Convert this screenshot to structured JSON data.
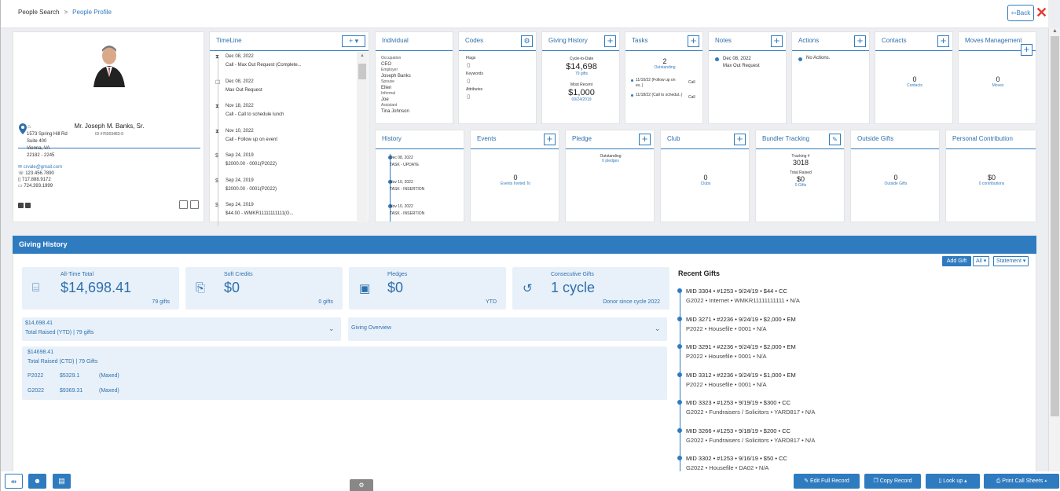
{
  "breadcrumb": {
    "home": "People Search",
    "sep": ">",
    "current": "People Profile"
  },
  "header": {
    "back_label": "Back",
    "close_label": "✕"
  },
  "profile": {
    "name": "Mr. Joseph M. Banks, Sr.",
    "id": "ID #76003483-9",
    "addr1": "1573 Spring Hill Rd",
    "addr2": "Suite 400",
    "addr3": "Vienna, VA",
    "addr4": "22182 - 2245",
    "email": "crvale@gmail.com",
    "phone1": "123.456.7890",
    "phone2": "717.888.9172",
    "phone3": "724.393.1999",
    "home_glyph": "⌂"
  },
  "timeline": {
    "title": "TimeLine",
    "add_label": "+ ▾",
    "items": [
      {
        "date": "Dec 08, 2022",
        "text": "Call - Max Out Request (Complete..."
      },
      {
        "date": "Dec 08, 2022",
        "text": "Max Out Request"
      },
      {
        "date": "Nov 18, 2022",
        "text": "Call - Call to schedule lunch"
      },
      {
        "date": "Nov 10, 2022",
        "text": "Call - Follow up on event"
      },
      {
        "date": "Sep 24, 2019",
        "text": "$2000.00 - 0001(P2022)"
      },
      {
        "date": "Sep 24, 2019",
        "text": "$2000.00 - 0001(P2022)"
      },
      {
        "date": "Sep 24, 2019",
        "text": "$44.00 - WMKR11111111111(G..."
      }
    ]
  },
  "individual": {
    "title": "Individual",
    "rows": [
      {
        "label": "Occupation",
        "value": "CEO"
      },
      {
        "label": "Employer",
        "value": "Joseph Banks"
      },
      {
        "label": "Spouse",
        "value": "Ellen"
      },
      {
        "label": "Informal",
        "value": "Joe"
      },
      {
        "label": "Assistant",
        "value": "Tina Johnson"
      }
    ]
  },
  "codes": {
    "title": "Codes",
    "rows": [
      {
        "label": "Flags",
        "value": "0"
      },
      {
        "label": "Keywords",
        "value": "0"
      },
      {
        "label": "Attributes",
        "value": "0"
      }
    ]
  },
  "giving_history_card": {
    "title": "Giving History",
    "cycle_label": "Cycle-to-Date",
    "cycle_value": "$14,698",
    "cycle_gifts": "79 gifts",
    "recent_label": "Most Recent",
    "recent_value": "$1,000",
    "recent_date": "09/24/2019"
  },
  "tasks": {
    "title": "Tasks",
    "count": "2",
    "count_label": "Outstanding",
    "items": [
      {
        "text": "11/10/22 (Follow up on ev..)",
        "type": "Call"
      },
      {
        "text": "11/18/22 (Call to schedul..)",
        "type": "Call"
      }
    ]
  },
  "notes": {
    "title": "Notes",
    "date": "Dec 08, 2022",
    "text": "Max Out Request"
  },
  "actions": {
    "title": "Actions",
    "text": "No Actions."
  },
  "contacts": {
    "title": "Contacts",
    "value": "0",
    "label": "Contacts"
  },
  "moves": {
    "title": "Moves Management",
    "value": "0",
    "label": "Moves"
  },
  "history": {
    "title": "History",
    "items": [
      {
        "date": "Dec 08, 2022",
        "text": "TASK - UPDATE"
      },
      {
        "date": "Nov 10, 2022",
        "text": "TASK - INSERTION"
      },
      {
        "date": "Nov 10, 2022",
        "text": "TASK - INSERTION"
      }
    ]
  },
  "events": {
    "title": "Events",
    "value": "0",
    "label": "Events Invited To"
  },
  "pledge": {
    "title": "Pledge",
    "label": "Outstanding",
    "sub": "0 pledges"
  },
  "club": {
    "title": "Club",
    "value": "0",
    "label": "Clubs"
  },
  "bundler": {
    "title": "Bundler Tracking",
    "tracking_label": "Tracking #",
    "tracking_value": "3018",
    "raised_label": "Total Raised",
    "raised_value": "$0",
    "gifts": "0 Gifts"
  },
  "outside": {
    "title": "Outside Gifts",
    "value": "0",
    "label": "Outside Gifts"
  },
  "personal": {
    "title": "Personal Contribution",
    "value": "$0",
    "label": "0 contributions"
  },
  "giving": {
    "title": "Giving History",
    "add_gift": "Add Gift",
    "all_label": "All ▾",
    "statement_label": "Statement ▾",
    "stats": [
      {
        "title": "All-Time Total",
        "value": "$14,698.41",
        "sub": "79 gifts"
      },
      {
        "title": "Soft Credits",
        "value": "$0",
        "sub": "0 gifts"
      },
      {
        "title": "Pledges",
        "value": "$0",
        "sub": "YTD"
      },
      {
        "title": "Consecutive Gifts",
        "value": "1 cycle",
        "sub": "Donor since cycle 2022"
      }
    ],
    "ytd_value": "$14,698.41",
    "ytd_label": "Total Raised (YTD) | 79 gifts",
    "overview_label": "Giving Overview",
    "ctd_value": "$14698.41",
    "ctd_label": "Total Raised (CTD) | 79 Gifts",
    "cycles": [
      {
        "name": "P2022",
        "amount": "$5329.1",
        "status": "(Maxed)"
      },
      {
        "name": "G2022",
        "amount": "$9369.31",
        "status": "(Maxed)"
      }
    ],
    "recent_title": "Recent Gifts",
    "recent": [
      {
        "l1": "MID 3304 • #1253 • 9/24/19 • $44 • CC",
        "l2": "G2022 • Internet • WMKR11111111111 • N/A"
      },
      {
        "l1": "MID 3271 • #2236 • 9/24/19 • $2,000 • EM",
        "l2": "P2022 • Housefile • 0001 • N/A"
      },
      {
        "l1": "MID 3291 • #2236 • 9/24/19 • $2,000 • EM",
        "l2": "P2022 • Housefile • 0001 • N/A"
      },
      {
        "l1": "MID 3312 • #2236 • 9/24/19 • $1,000 • EM",
        "l2": "P2022 • Housefile • 0001 • N/A"
      },
      {
        "l1": "MID 3323 • #1253 • 9/19/19 • $300 • CC",
        "l2": "G2022 • Fundraisers / Solicitors • YARD817 • N/A"
      },
      {
        "l1": "MID 3266 • #1253 • 9/18/19 • $200 • CC",
        "l2": "G2022 • Fundraisers / Solicitors • YARD817 • N/A"
      },
      {
        "l1": "MID 3302 • #1253 • 9/16/19 • $50 • CC",
        "l2": "G2022 • Housefile • DA02 • N/A"
      }
    ]
  },
  "footer": {
    "edit_label": "Edit Full Record",
    "copy_label": "Copy Record",
    "lookup_label": "Look up ▴",
    "print_label": "Print Call Sheets ▴"
  },
  "colors": {
    "accent": "#2f7bbf",
    "close": "#e53935",
    "light_panel": "#e8f1fa"
  }
}
